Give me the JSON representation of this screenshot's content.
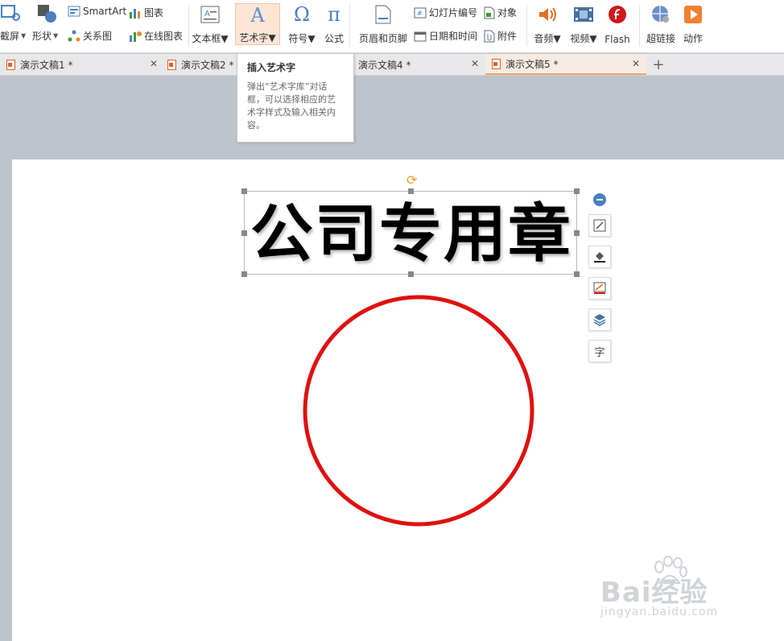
{
  "ribbon": {
    "crop": "截屏",
    "shape": "形状",
    "smartart": "SmartArt",
    "chart": "图表",
    "relation": "关系图",
    "online_chart": "在线图表",
    "textbox": "文本框",
    "wordart": "艺术字",
    "symbol": "符号",
    "formula": "公式",
    "header_footer": "页眉和页脚",
    "slide_number": "幻灯片编号",
    "object": "对象",
    "datetime": "日期和时间",
    "attachment": "附件",
    "audio": "音频",
    "video": "视频",
    "flash": "Flash",
    "hyperlink": "超链接",
    "action": "动作"
  },
  "tooltip": {
    "title": "插入艺术字",
    "body": "弹出“艺术字库”对话框，可以选择相应的艺术字样式及输入相关内容。"
  },
  "tabs": [
    {
      "label": "演示文稿1 *"
    },
    {
      "label": "演示文稿2 *"
    },
    {
      "label": "演示文稿4 *"
    },
    {
      "label": "演示文稿5 *"
    }
  ],
  "slide": {
    "wordart_text": "公司专用章"
  },
  "watermark": {
    "brand": "Bai经验",
    "url": "jingyan.baidu.com"
  },
  "colors": {
    "seal_red": "#e01010",
    "accent_orange": "#f0a070"
  }
}
